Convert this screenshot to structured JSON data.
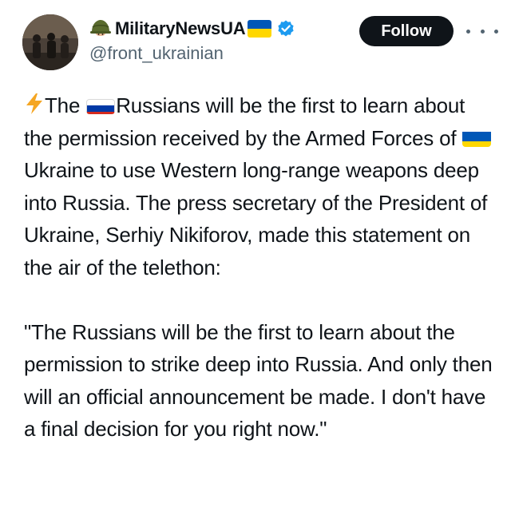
{
  "author": {
    "display_name": "MilitaryNewsUA",
    "handle": "@front_ukrainian",
    "emoji_icon": "military-helmet-icon",
    "flag_icon": "ukraine-flag-icon",
    "verified_icon": "verified-badge-icon"
  },
  "actions": {
    "follow_label": "Follow",
    "more_icon": "more-options-icon"
  },
  "post": {
    "p1": {
      "lead_icon": "lightning-icon",
      "s1": "The ",
      "flag1": "russia-flag-icon",
      "s2": "Russians will be the first to learn about the permission received by the Armed Forces of ",
      "flag2": "ukraine-flag-icon",
      "s3": "Ukraine to use Western long-range weapons deep into Russia. The press secretary of the President of Ukraine, Serhiy Nikiforov, made this statement on the air of the telethon:"
    },
    "p2": "\"The Russians will be the first to learn about the permission to strike deep into Russia. And only then will an official announcement be made. I don't have a final decision for you right now.\""
  },
  "colors": {
    "text": "#0f1419",
    "secondary": "#536471",
    "verified": "#1d9bf0",
    "follow_bg": "#0f1419",
    "ukraine_blue": "#0057b7",
    "ukraine_yellow": "#ffd700",
    "russia_white": "#ffffff",
    "russia_blue": "#0039a6",
    "russia_red": "#d52b1e",
    "lightning": "#f5a623"
  }
}
